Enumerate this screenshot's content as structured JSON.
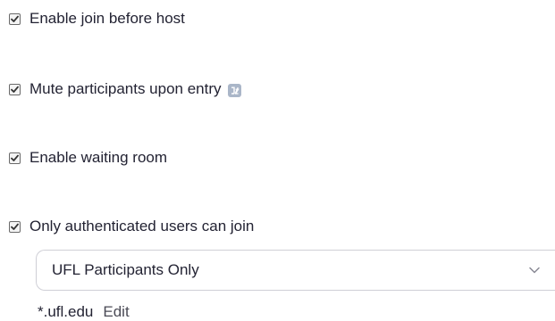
{
  "options": [
    {
      "label": "Enable join before host",
      "checked": true
    },
    {
      "label": "Mute participants upon entry",
      "checked": true,
      "icon": "info-icon"
    },
    {
      "label": "Enable waiting room",
      "checked": true
    },
    {
      "label": "Only authenticated users can join",
      "checked": true
    }
  ],
  "auth_select": {
    "selected": "UFL Participants Only"
  },
  "domain": {
    "value": "*.ufl.edu",
    "edit_label": "Edit"
  },
  "colors": {
    "text": "#232333",
    "info_icon": "#aab6c8",
    "select_border": "#cfcfd6"
  }
}
